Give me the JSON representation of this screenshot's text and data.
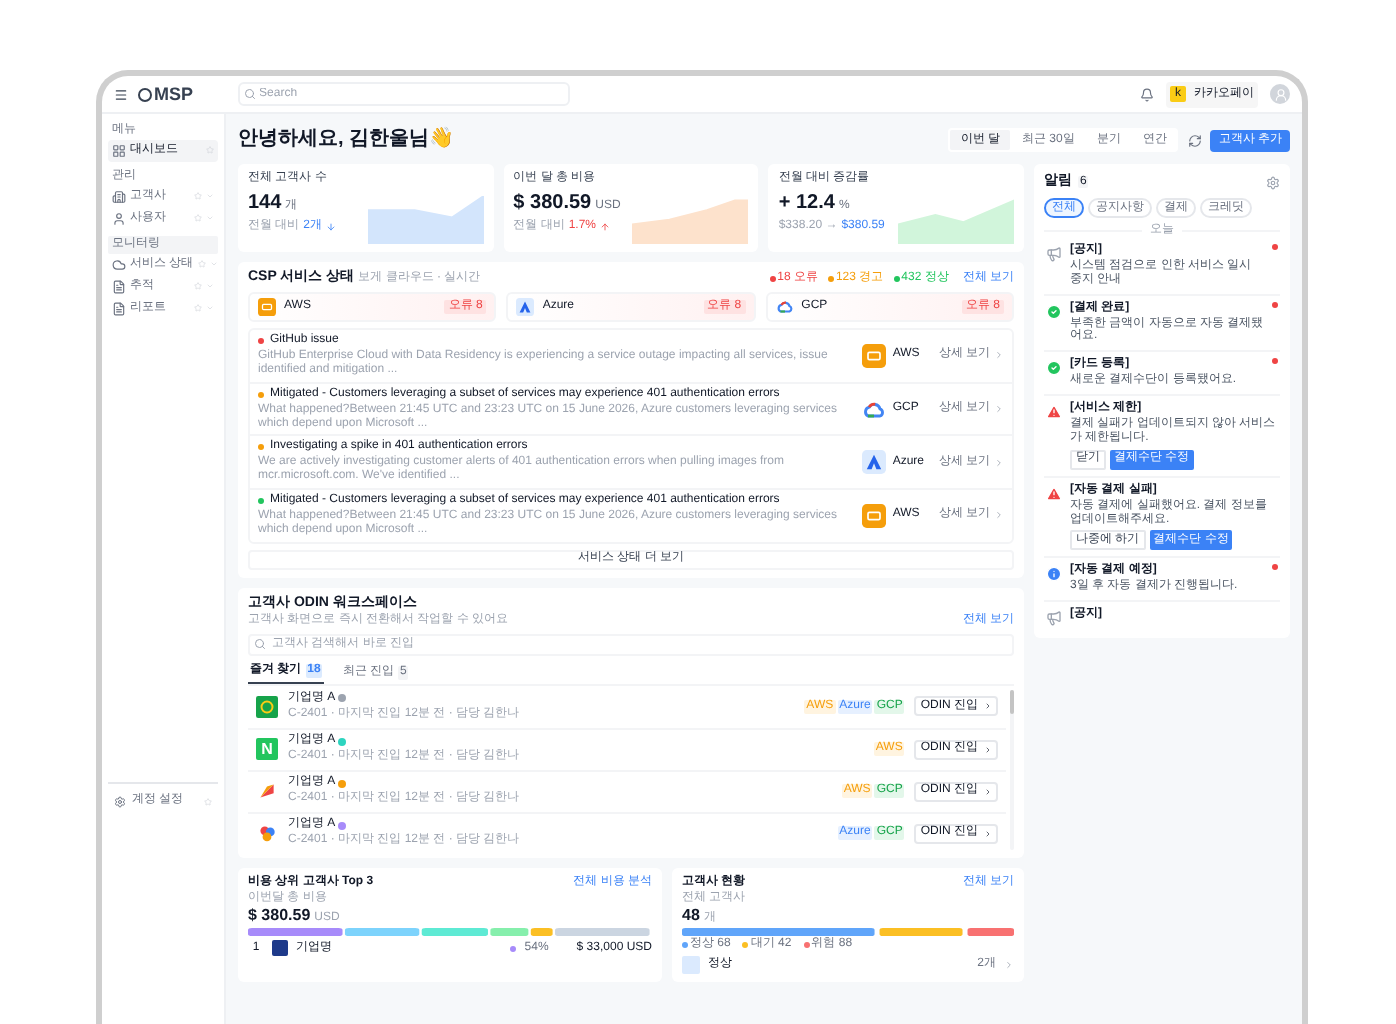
{
  "header": {
    "logo": "MSP",
    "search": {
      "placeholder": "Search"
    },
    "org": {
      "badge": "k",
      "name": "카카오페이"
    }
  },
  "sidebar": {
    "sections": [
      {
        "label": "메뉴",
        "boxed": false,
        "items": [
          {
            "label": "대시보드",
            "kind": "grid",
            "selected": true
          }
        ]
      },
      {
        "label": "관리",
        "boxed": false,
        "items": [
          {
            "label": "고객사",
            "kind": "building",
            "selected": false
          },
          {
            "label": "사용자",
            "kind": "user",
            "selected": false
          }
        ]
      },
      {
        "label": "모니터링",
        "boxed": true,
        "items": [
          {
            "label": "서비스 상태",
            "kind": "cloud",
            "selected": false
          },
          {
            "label": "추적",
            "kind": "doc",
            "selected": false
          },
          {
            "label": "리포트",
            "kind": "doc",
            "selected": false
          }
        ]
      }
    ],
    "footer": {
      "label": "계정 설정"
    }
  },
  "greeting": "안녕하세요, 김한울님👋",
  "periods": [
    {
      "label": "이번 달",
      "selected": true
    },
    {
      "label": "최근 30일",
      "selected": false
    },
    {
      "label": "분기",
      "selected": false
    },
    {
      "label": "연간",
      "selected": false
    }
  ],
  "add_button": "고객사 추가",
  "stats": [
    {
      "label": "전체 고객사 수",
      "value": "144",
      "unit": "개",
      "color": "#d3e5fc",
      "note": "전월 대비",
      "delta": "2개",
      "kind": "down"
    },
    {
      "label": "이번 달 총 비용",
      "value": "$ 380.59",
      "unit": "USD",
      "color": "#fde2cc",
      "note": "전월 대비",
      "delta": "1.7%",
      "kind": "up"
    },
    {
      "label": "전월 대비 증감률",
      "value": "+ 12.4",
      "unit": "%",
      "color": "#d1f5db",
      "note": "$338.20 →",
      "delta": "$380.59",
      "kind": "flat"
    }
  ],
  "csp": {
    "title": "CSP 서비스 상태",
    "subtitle": "보게 클라우드 · 실시간",
    "counts": [
      {
        "label": "18 오류",
        "color": "#ef4444"
      },
      {
        "label": "123 경고",
        "color": "#f59e0b"
      },
      {
        "label": "432 정상",
        "color": "#22c55e"
      }
    ],
    "view_all": "전체 보기",
    "providers": [
      {
        "name": "AWS",
        "kind": "aws",
        "badge": "오류 8"
      },
      {
        "name": "Azure",
        "kind": "azure",
        "badge": "오류 8"
      },
      {
        "name": "GCP",
        "kind": "gcp",
        "badge": "오류 8"
      }
    ],
    "incidents": [
      {
        "title": "GitHub issue",
        "desc": "GitHub Enterprise Cloud with Data Residency is experiencing a service outage impacting all services, issue identified and mitigation ...",
        "color": "#ef4444",
        "provider": "AWS",
        "kind": "aws",
        "link": "상세 보기"
      },
      {
        "title": "Mitigated - Customers leveraging a subset of services may experience 401 authentication errors",
        "desc": "What happened?Between 21:45 UTC and 23:23 UTC on 15 June 2026, Azure customers leveraging services which depend upon Microsoft ...",
        "color": "#f59e0b",
        "provider": "GCP",
        "kind": "gcp",
        "link": "상세 보기"
      },
      {
        "title": "Investigating a spike in 401 authentication errors",
        "desc": "We are actively investigating customer alerts of 401 authentication errors when pulling images from mcr.microsoft.com. We've identified ...",
        "color": "#f59e0b",
        "provider": "Azure",
        "kind": "azure",
        "link": "상세 보기"
      },
      {
        "title": "Mitigated - Customers leveraging a subset of services may experience 401 authentication errors",
        "desc": "What happened?Between 21:45 UTC and 23:23 UTC on 15 June 2026, Azure customers leveraging services which depend upon Microsoft ...",
        "color": "#22c55e",
        "provider": "AWS",
        "kind": "aws",
        "link": "상세 보기"
      }
    ],
    "more": "서비스 상태 더 보기"
  },
  "workspace": {
    "title": "고객사 ODIN 워크스페이스",
    "subtitle": "고객사 화면으로 즉시 전환해서 작업할 수 있어요",
    "view_all": "전체 보기",
    "search": {
      "placeholder": "고객사 검색해서 바로 진입"
    },
    "tabs": [
      {
        "label": "즐겨 찾기",
        "count": "18",
        "selected": true
      },
      {
        "label": "최근 진입",
        "count": "5",
        "selected": false
      }
    ],
    "rows": [
      {
        "name": "기업명 A",
        "kind": "shield",
        "color": "#9ca3af",
        "meta": "C-2401 · 마지막 진입 12분 전 · 담당 김한나",
        "tags": [
          {
            "label": "AWS",
            "kind": "aws"
          },
          {
            "label": "Azure",
            "kind": "azure"
          },
          {
            "label": "GCP",
            "kind": "gcp"
          }
        ],
        "action": "ODIN 진입"
      },
      {
        "name": "기업명 A",
        "kind": "letter",
        "logo_text": "N",
        "color": "#2dd4bf",
        "meta": "C-2401 · 마지막 진입 12분 전 · 담당 김한나",
        "tags": [
          {
            "label": "AWS",
            "kind": "aws"
          }
        ],
        "action": "ODIN 진입"
      },
      {
        "name": "기업명 A",
        "kind": "arrow",
        "color": "#f59e0b",
        "meta": "C-2401 · 마지막 진입 12분 전 · 담당 김한나",
        "tags": [
          {
            "label": "AWS",
            "kind": "aws"
          },
          {
            "label": "GCP",
            "kind": "gcp"
          }
        ],
        "action": "ODIN 진입"
      },
      {
        "name": "기업명 A",
        "kind": "flower",
        "color": "#a78bfa",
        "meta": "C-2401 · 마지막 진입 12분 전 · 담당 김한나",
        "tags": [
          {
            "label": "Azure",
            "kind": "azure"
          },
          {
            "label": "GCP",
            "kind": "gcp"
          }
        ],
        "action": "ODIN 진입"
      }
    ]
  },
  "top_cost": {
    "title": "비용 상위 고객사 Top 3",
    "link": "전체 비용 분석",
    "label": "이번달 총 비용",
    "value": "$ 380.59",
    "unit": "USD",
    "segments": [
      {
        "color": "#a78bfa"
      },
      {
        "color": "#7dd3fc"
      },
      {
        "color": "#5eead4"
      },
      {
        "color": "#86efac"
      },
      {
        "color": "#fbbf24"
      },
      {
        "color": "#cbd5e1"
      }
    ],
    "rows": [
      {
        "rank": "1",
        "name": "기업명",
        "share": "54%",
        "color": "#a78bfa",
        "amount": "$ 33,000 USD"
      }
    ]
  },
  "status": {
    "title": "고객사 현황",
    "link": "전체 보기",
    "label": "전체 고객사",
    "value": "48",
    "unit": "개",
    "segments": [
      {
        "label": "정상 68",
        "color": "#60a5fa"
      },
      {
        "label": "대기 42",
        "color": "#fbbf24"
      },
      {
        "label": "위험 88",
        "color": "#f87171"
      }
    ],
    "rows": [
      {
        "label": "정상",
        "count": "2개"
      }
    ]
  },
  "alerts": {
    "title": "알림",
    "count": "6",
    "filters": [
      {
        "label": "전체",
        "selected": true
      },
      {
        "label": "공지사항",
        "selected": false
      },
      {
        "label": "결제",
        "selected": false
      },
      {
        "label": "크레딧",
        "selected": false
      }
    ],
    "day": "오늘",
    "items": [
      {
        "kind": "notice",
        "title": "[공지]",
        "body": "시스템 점검으로 인한 서비스 일시 중지 안내",
        "unread": true
      },
      {
        "kind": "success",
        "title": "[결제 완료]",
        "body": "부족한 금액이 자동으로 자동 결제됐어요.",
        "unread": true
      },
      {
        "kind": "success",
        "title": "[카드 등록]",
        "body": "새로운 결제수단이 등록됐어요.",
        "unread": true
      },
      {
        "kind": "error",
        "title": "[서비스 제한]",
        "body": "결제 실패가 업데이트되지 않아 서비스가 제한됩니다.",
        "unread": false,
        "actions": [
          {
            "label": "닫기",
            "primary": false
          },
          {
            "label": "결제수단 수정",
            "primary": true
          }
        ]
      },
      {
        "kind": "error",
        "title": "[자동 결제 실패]",
        "body": "자동 결제에 실패했어요. 결제 정보를 업데이트해주세요.",
        "unread": false,
        "actions": [
          {
            "label": "나중에 하기",
            "primary": false
          },
          {
            "label": "결제수단 수정",
            "primary": true
          }
        ]
      },
      {
        "kind": "info",
        "title": "[자동 결제 예정]",
        "body": "3일 후 자동 결제가 진행됩니다.",
        "unread": true
      },
      {
        "kind": "notice",
        "title": "[공지]",
        "unread": false
      }
    ]
  }
}
